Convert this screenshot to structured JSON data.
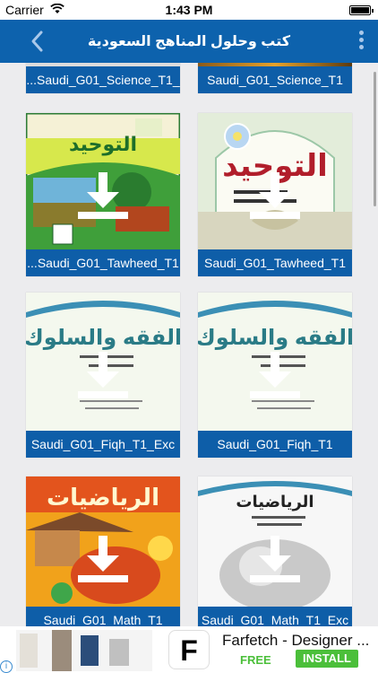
{
  "status_bar": {
    "carrier": "Carrier",
    "time": "1:43 PM"
  },
  "nav": {
    "title": "كتب وحلول المناهج السعودية",
    "back_icon": "chevron-left-icon",
    "menu_icon": "more-vertical-icon"
  },
  "books": [
    {
      "label": "...Saudi_G01_Science_T1_",
      "cover": "science-partial"
    },
    {
      "label": "Saudi_G01_Science_T1",
      "cover": "science-partial"
    },
    {
      "label": "...Saudi_G01_Tawheed_T1",
      "cover": "tawheed-workbook",
      "cover_title": "التوحيد"
    },
    {
      "label": "Saudi_G01_Tawheed_T1",
      "cover": "tawheed-student",
      "cover_title": "التوحيد"
    },
    {
      "label": "Saudi_G01_Fiqh_T1",
      "cover": "fiqh",
      "cover_title": "الفقه والسلوك"
    },
    {
      "label": "Saudi_G01_Fiqh_T1_Exc",
      "cover": "fiqh",
      "cover_title": "الفقه والسلوك"
    },
    {
      "label": "Saudi_G01_Math_T1_Exc",
      "cover": "math-exercises",
      "cover_title": "الرياضيات"
    },
    {
      "label": "Saudi_G01_Math_T1",
      "cover": "math-student",
      "cover_title": "الرياضيات"
    }
  ],
  "ad": {
    "app_name": "Farfetch - Designer ...",
    "price": "FREE",
    "install_label": "INSTALL",
    "logo_letter": "F",
    "info_icon": "info-icon"
  },
  "colors": {
    "nav_blue": "#0d62ad",
    "label_blue": "#0e5ea8",
    "install_green": "#4bbf3a"
  }
}
